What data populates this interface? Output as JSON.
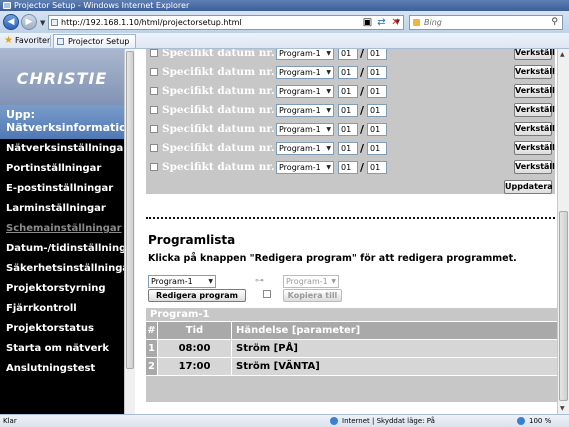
{
  "window": {
    "title": "Projector Setup - Windows Internet Explorer"
  },
  "browser": {
    "url": "http://192.168.1.10/html/projectorsetup.html",
    "search_placeholder": "Bing",
    "favorites_label": "Favoriter",
    "tab_label": "Projector Setup"
  },
  "sidebar": {
    "logo": "CHRISTIE",
    "section_title": "Upp: Nätverksinformation",
    "items": [
      "Nätverksinställningar",
      "Portinställningar",
      "E-postinställningar",
      "Larminställningar",
      "Schemainställningar",
      "Datum-/tidinställningar",
      "Säkerhetsinställningar",
      "Projektorstyrning",
      "Fjärrkontroll",
      "Projektorstatus",
      "Starta om nätverk",
      "Anslutningstest"
    ]
  },
  "dates": {
    "rows": [
      {
        "label": "Specifikt datum nr. 4",
        "program": "Program-1",
        "month": "01",
        "day": "01"
      },
      {
        "label": "Specifikt datum nr. 5",
        "program": "Program-1",
        "month": "01",
        "day": "01"
      },
      {
        "label": "Specifikt datum nr. 6",
        "program": "Program-1",
        "month": "01",
        "day": "01"
      },
      {
        "label": "Specifikt datum nr. 7",
        "program": "Program-1",
        "month": "01",
        "day": "01"
      },
      {
        "label": "Specifikt datum nr. 8",
        "program": "Program-1",
        "month": "01",
        "day": "01"
      },
      {
        "label": "Specifikt datum nr. 9",
        "program": "Program-1",
        "month": "01",
        "day": "01"
      },
      {
        "label": "Specifikt datum nr. 10",
        "program": "Program-1",
        "month": "01",
        "day": "01"
      }
    ],
    "apply_label": "Verkställ",
    "update_label": "Uppdatera"
  },
  "programlist": {
    "title": "Programlista",
    "instruction": "Klicka på knappen \"Redigera program\" för att redigera programmet.",
    "select_value": "Program-1",
    "copy_select_value": "Program-1",
    "edit_label": "Redigera program",
    "copy_label": "Kopiera till"
  },
  "program_table": {
    "title": "Program-1",
    "headers": [
      "#",
      "Tid",
      "Händelse [parameter]"
    ],
    "rows": [
      {
        "num": "1",
        "time": "08:00",
        "event": "Ström [PÅ]"
      },
      {
        "num": "2",
        "time": "17:00",
        "event": "Ström [VÄNTA]"
      }
    ]
  },
  "status": {
    "left": "Klar",
    "zone": "Internet | Skyddat läge: På",
    "zoom": "100 %"
  }
}
